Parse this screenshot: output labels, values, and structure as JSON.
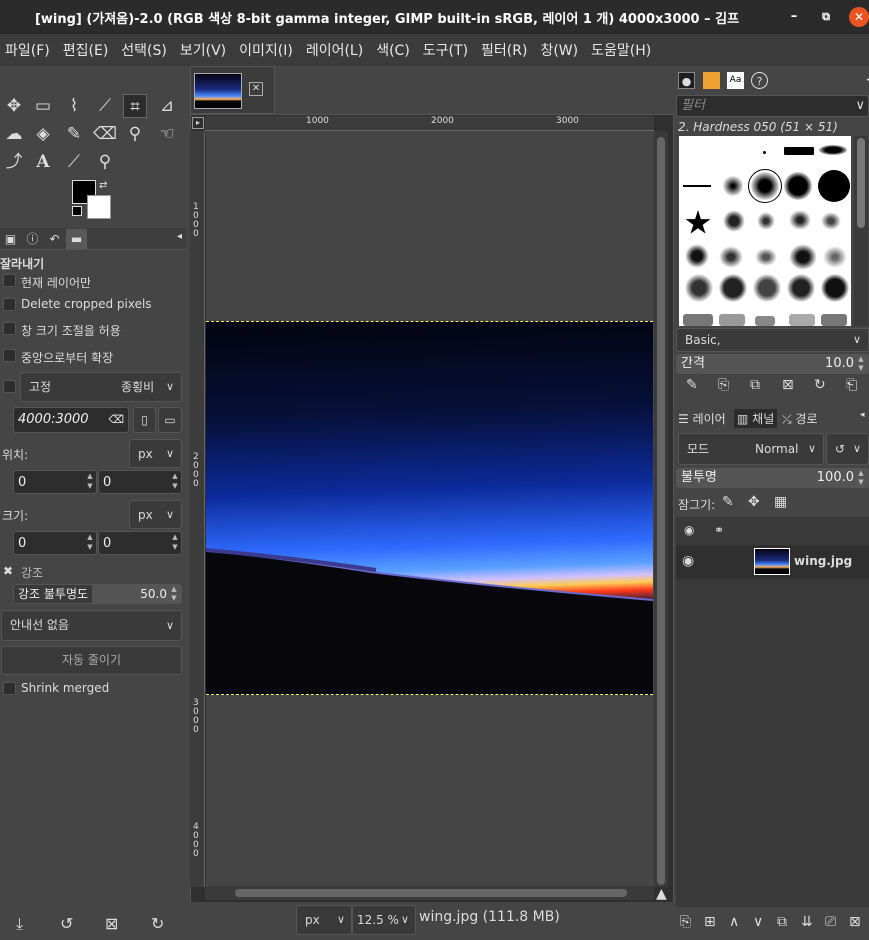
{
  "window": {
    "title": "[wing] (가져옴)-2.0 (RGB 색상 8-bit gamma integer, GIMP built-in sRGB, 레이어 1 개) 4000x3000 – 김프",
    "minimize": "–",
    "maximize": "⧉",
    "close": "✕"
  },
  "menu": [
    "파일(F)",
    "편집(E)",
    "선택(S)",
    "보기(V)",
    "이미지(I)",
    "레이어(L)",
    "색(C)",
    "도구(T)",
    "필터(R)",
    "창(W)",
    "도움말(H)"
  ],
  "tool_options": {
    "title": "잘라내기",
    "current_layer_only": "현재 레이어만",
    "delete_cropped": "Delete cropped pixels",
    "allow_growing": "창 크기 조절을 허용",
    "expand_center": "중앙으로부터 확장",
    "fixed_label": "고정",
    "fixed_mode": "종횡비",
    "ratio": "4000:3000",
    "position_label": "위치:",
    "position_unit": "px",
    "pos_x": "0",
    "pos_y": "0",
    "size_label": "크기:",
    "size_unit": "px",
    "size_w": "0",
    "size_h": "0",
    "highlight_label": "강조",
    "highlight_opacity_label": "강조 불투명도",
    "highlight_opacity": "50.0",
    "guides": "안내선 없음",
    "auto_shrink": "자동 줄이기",
    "shrink_merged": "Shrink merged"
  },
  "ruler": {
    "h_labels": [
      "1000",
      "2000",
      "3000"
    ],
    "v_labels": [
      "1000",
      "2000",
      "3000",
      "4000"
    ]
  },
  "status": {
    "unit": "px",
    "zoom": "12.5 %",
    "info": "wing.jpg (111.8 MB)"
  },
  "brushes": {
    "filter_placeholder": "필터",
    "selected": "2. Hardness 050 (51 × 51)",
    "preset": "Basic,",
    "spacing_label": "간격",
    "spacing": "10.0"
  },
  "layers": {
    "tabs": [
      "레이어",
      "채널",
      "경로"
    ],
    "mode_label": "모드",
    "mode": "Normal",
    "opacity_label": "불투명",
    "opacity": "100.0",
    "lock_label": "잠그기:",
    "layer_name": "wing.jpg"
  }
}
